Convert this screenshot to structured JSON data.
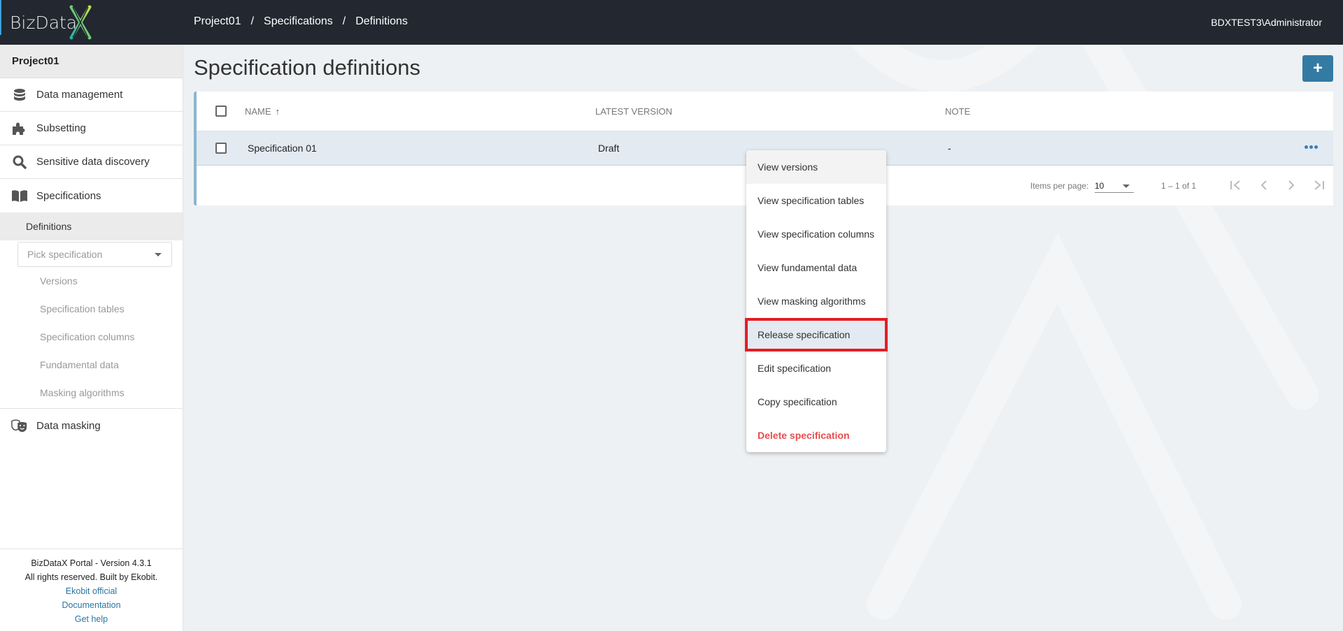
{
  "header": {
    "logo_text": "BizData",
    "breadcrumb": [
      "Project01",
      "Specifications",
      "Definitions"
    ],
    "breadcrumb_separator": "/",
    "user": "BDXTEST3\\Administrator"
  },
  "sidebar": {
    "project": "Project01",
    "items": [
      {
        "label": "Data management",
        "icon": "database-icon"
      },
      {
        "label": "Subsetting",
        "icon": "puzzle-icon"
      },
      {
        "label": "Sensitive data discovery",
        "icon": "search-icon"
      },
      {
        "label": "Specifications",
        "icon": "book-icon"
      }
    ],
    "active_sub": "Definitions",
    "pick_placeholder": "Pick specification",
    "sub_links": [
      "Versions",
      "Specification tables",
      "Specification columns",
      "Fundamental data",
      "Masking algorithms"
    ],
    "data_masking": {
      "label": "Data masking",
      "icon": "theater-masks-icon"
    },
    "footer": {
      "version": "BizDataX Portal - Version 4.3.1",
      "rights": "All rights reserved. Built by Ekobit.",
      "links": [
        "Ekobit official",
        "Documentation",
        "Get help"
      ]
    }
  },
  "main": {
    "title": "Specification definitions",
    "add_button": "+",
    "table": {
      "columns": [
        "NAME",
        "LATEST VERSION",
        "NOTE"
      ],
      "sort_indicator": "↑",
      "rows": [
        {
          "name": "Specification 01",
          "latest_version": "Draft",
          "note": "-"
        }
      ]
    },
    "pager": {
      "items_per_page_label": "Items per page:",
      "items_per_page": "10",
      "range": "1 – 1 of 1"
    }
  },
  "context_menu": {
    "items": [
      "View versions",
      "View specification tables",
      "View specification columns",
      "View fundamental data",
      "View masking algorithms",
      "Release specification",
      "Edit specification",
      "Copy specification",
      "Delete specification"
    ],
    "highlighted": "Release specification"
  },
  "colors": {
    "topbar": "#222730",
    "accent": "#337ba3",
    "danger": "#e94d4d",
    "highlight_box": "#e51d24",
    "row_selected": "#e3eaf1"
  }
}
